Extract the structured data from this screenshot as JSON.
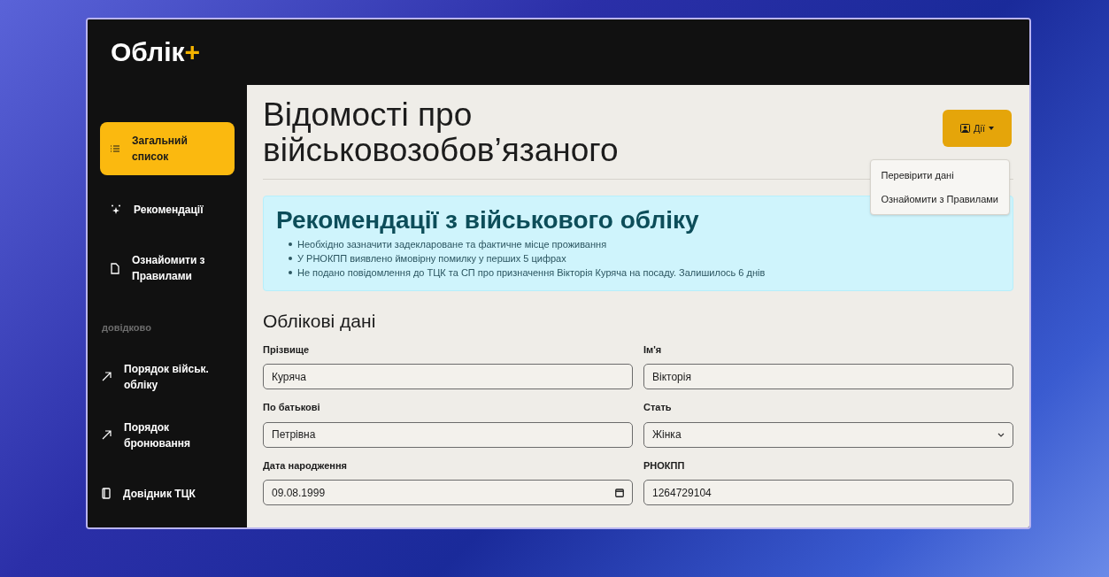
{
  "app": {
    "logo": "Облік",
    "logo_mark": "+"
  },
  "sidebar": {
    "items": [
      {
        "label": "Загальний список",
        "kind": "list",
        "selected": true
      },
      {
        "label": "Рекомендації",
        "kind": "sparkle",
        "selected": false
      },
      {
        "label": "Ознайомити з Правилами",
        "kind": "file",
        "selected": false
      }
    ],
    "section": "довідково",
    "links": [
      {
        "label": "Порядок військ. обліку",
        "kind": "arrow"
      },
      {
        "label": "Порядок бронювання",
        "kind": "arrow"
      },
      {
        "label": "Довідник ТЦК",
        "kind": "book"
      }
    ]
  },
  "page": {
    "title": "Відомості про військовозобов’язаного",
    "actions_button": "Дії",
    "actions_menu": {
      "expanded": true,
      "items": [
        "Перевірити дані",
        "Ознайомити з Правилами"
      ]
    }
  },
  "recommendations": {
    "title": "Рекомендації з військового обліку",
    "items": [
      "Необхідно зазначити задеклароване та фактичне місце проживання",
      "У РНОКПП виявлено ймовірну помилку у перших 5 цифрах",
      "Не подано повідомлення до ТЦК та СП про призначення Вікторія Куряча на посаду. Залишилось 6 днів"
    ]
  },
  "record": {
    "title": "Облікові дані",
    "fields": [
      {
        "label": "Прізвище",
        "value": "Куряча",
        "kind": "text"
      },
      {
        "label": "Ім'я",
        "value": "Вікторія",
        "kind": "text"
      },
      {
        "label": "По батькові",
        "value": "Петрівна",
        "kind": "text"
      },
      {
        "label": "Стать",
        "value": "Жінка",
        "kind": "select"
      },
      {
        "label": "Дата народження",
        "value": "09.08.1999",
        "kind": "date"
      },
      {
        "label": "РНОКПП",
        "value": "1264729104",
        "kind": "text"
      }
    ]
  }
}
